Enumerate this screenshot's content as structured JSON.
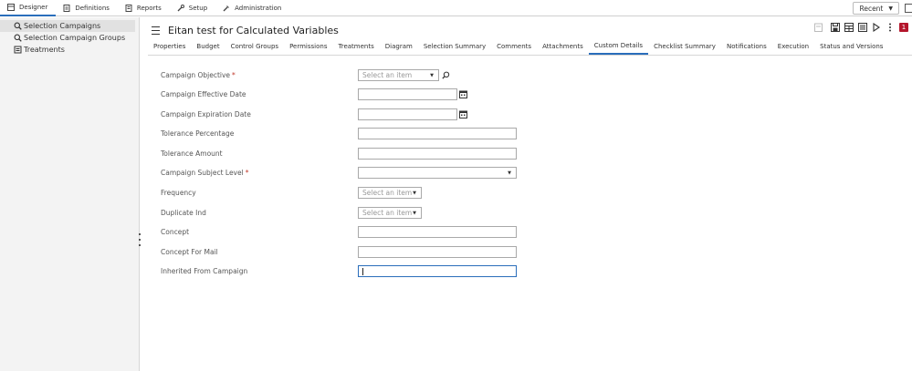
{
  "topnav": {
    "items": [
      {
        "label": "Designer",
        "icon": "designer-icon",
        "active": true
      },
      {
        "label": "Definitions",
        "icon": "definitions-icon",
        "active": false
      },
      {
        "label": "Reports",
        "icon": "reports-icon",
        "active": false
      },
      {
        "label": "Setup",
        "icon": "setup-icon",
        "active": false
      },
      {
        "label": "Administration",
        "icon": "administration-icon",
        "active": false
      }
    ],
    "recent_label": "Recent"
  },
  "sidebar": {
    "items": [
      {
        "label": "Selection Campaigns",
        "icon": "magnifier-icon",
        "active": true
      },
      {
        "label": "Selection Campaign Groups",
        "icon": "magnifier-icon",
        "active": false
      },
      {
        "label": "Treatments",
        "icon": "treatment-icon",
        "active": false
      }
    ]
  },
  "header": {
    "title": "Eitan test for Calculated Variables",
    "badge": "1"
  },
  "tabs": [
    {
      "label": "Properties",
      "active": false
    },
    {
      "label": "Budget",
      "active": false
    },
    {
      "label": "Control Groups",
      "active": false
    },
    {
      "label": "Permissions",
      "active": false
    },
    {
      "label": "Treatments",
      "active": false
    },
    {
      "label": "Diagram",
      "active": false
    },
    {
      "label": "Selection Summary",
      "active": false
    },
    {
      "label": "Comments",
      "active": false
    },
    {
      "label": "Attachments",
      "active": false
    },
    {
      "label": "Custom Details",
      "active": true
    },
    {
      "label": "Checklist Summary",
      "active": false
    },
    {
      "label": "Notifications",
      "active": false
    },
    {
      "label": "Execution",
      "active": false
    },
    {
      "label": "Status and Versions",
      "active": false
    }
  ],
  "form": {
    "fields": [
      {
        "label": "Campaign Objective",
        "required": true,
        "type": "select-lookup",
        "placeholder": "Select an item",
        "value": ""
      },
      {
        "label": "Campaign Effective Date",
        "required": false,
        "type": "date",
        "value": ""
      },
      {
        "label": "Campaign Expiration Date",
        "required": false,
        "type": "date",
        "value": ""
      },
      {
        "label": "Tolerance Percentage",
        "required": false,
        "type": "text",
        "value": ""
      },
      {
        "label": "Tolerance Amount",
        "required": false,
        "type": "text",
        "value": ""
      },
      {
        "label": "Campaign Subject Level",
        "required": true,
        "type": "select-wide",
        "placeholder": "",
        "value": ""
      },
      {
        "label": "Frequency",
        "required": false,
        "type": "select-small",
        "placeholder": "Select an item",
        "value": ""
      },
      {
        "label": "Duplicate Ind",
        "required": false,
        "type": "select-small",
        "placeholder": "Select an item",
        "value": ""
      },
      {
        "label": "Concept",
        "required": false,
        "type": "text",
        "value": ""
      },
      {
        "label": "Concept For Mail",
        "required": false,
        "type": "text",
        "value": ""
      },
      {
        "label": "Inherited From Campaign",
        "required": false,
        "type": "text-focused",
        "value": ""
      }
    ],
    "required_marker": "*"
  },
  "colors": {
    "accent": "#2a6ebb",
    "badge": "#b4162c",
    "required": "#c0392b"
  }
}
